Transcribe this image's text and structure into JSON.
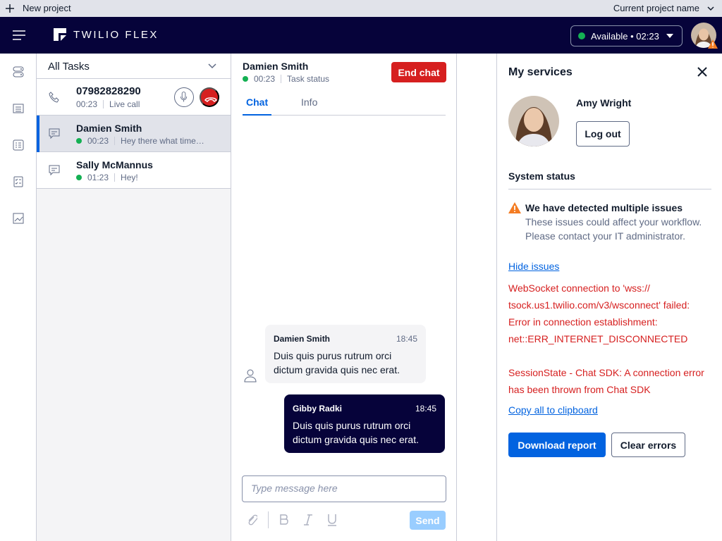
{
  "project_bar": {
    "new_project": "New project",
    "current_project": "Current project name"
  },
  "header": {
    "brand": "TWILIO FLEX",
    "availability": "Available • 02:23"
  },
  "rail": {
    "icons": [
      "agent-desktop-icon",
      "queues-icon",
      "teams-icon",
      "tasks-icon",
      "analytics-icon"
    ]
  },
  "task_list": {
    "filter": "All Tasks",
    "tasks": [
      {
        "name": "07982828290",
        "time": "00:23",
        "status": "Live call"
      },
      {
        "name": "Damien Smith",
        "time": "00:23",
        "preview": "Hey there what time ca..."
      },
      {
        "name": "Sally McMannus",
        "time": "01:23",
        "preview": "Hey!"
      }
    ]
  },
  "chat": {
    "contact": "Damien Smith",
    "time": "00:23",
    "status": "Task status",
    "end_label": "End chat",
    "tabs": [
      "Chat",
      "Info"
    ],
    "messages": [
      {
        "author": "Damien Smith",
        "time": "18:45",
        "text": "Duis quis purus rutrum orci dictum gravida quis nec erat."
      },
      {
        "author": "Gibby Radki",
        "time": "18:45",
        "text": "Duis quis purus rutrum orci dictum gravida quis nec erat."
      }
    ],
    "input_placeholder": "Type message here",
    "send_label": "Send"
  },
  "services": {
    "title": "My services",
    "user_name": "Amy Wright",
    "logout_label": "Log out",
    "system_status": "System status",
    "issue_title": "We have detected multiple issues",
    "issue_desc": "These issues could affect your workflow. Please contact your IT administrator.",
    "hide_issues": "Hide issues",
    "errors": [
      "WebSocket connection to 'wss:// tsock.us1.twilio.com/v3/wsconnect' failed: Error in connection establishment: net::ERR_INTERNET_DISCONNECTED",
      "SessionState - Chat SDK: A connection error has been thrown from Chat SDK"
    ],
    "copy_label": "Copy all to clipboard",
    "download_label": "Download report",
    "clear_label": "Clear errors"
  },
  "colors": {
    "header_bg": "#06033a",
    "primary": "#0263e0",
    "danger": "#d61f1f",
    "available": "#14b053",
    "warning": "#f47c22"
  }
}
